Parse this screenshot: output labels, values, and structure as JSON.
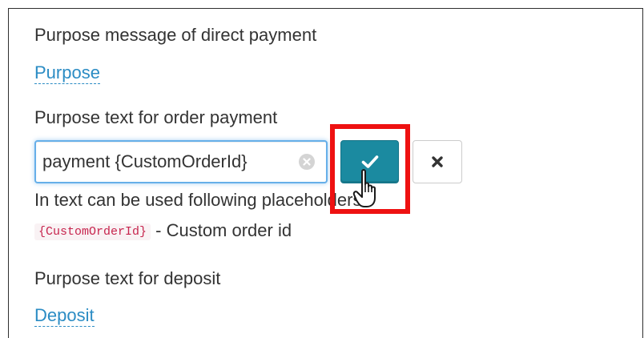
{
  "sections": {
    "direct_payment": {
      "label": "Purpose message of direct payment",
      "link": "Purpose"
    },
    "order_payment": {
      "label": "Purpose text for order payment",
      "input_value": "payment {CustomOrderId}",
      "hint": "In text can be used following placeholders:",
      "placeholder_code": "{CustomOrderId}",
      "placeholder_desc": " - Custom order id"
    },
    "deposit": {
      "label": "Purpose text for deposit",
      "link": "Deposit"
    }
  },
  "buttons": {
    "confirm_icon": "check-icon",
    "cancel_icon": "close-icon",
    "clear_icon": "clear-circle-icon"
  },
  "colors": {
    "link": "#2b8cc4",
    "confirm_button": "#1b8aa0",
    "highlight": "#ee1111",
    "code_text": "#c7254e",
    "input_focus": "#66afe9"
  }
}
